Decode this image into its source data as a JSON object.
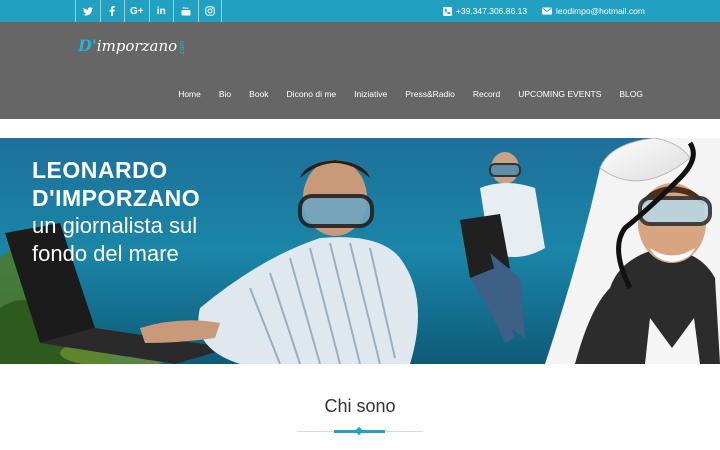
{
  "topbar": {
    "social": [
      {
        "icon": "twitter-icon",
        "glyph": "🐦"
      },
      {
        "icon": "facebook-icon",
        "glyph": "f"
      },
      {
        "icon": "google-plus-icon",
        "glyph": "G+"
      },
      {
        "icon": "linkedin-icon",
        "glyph": "in"
      },
      {
        "icon": "youtube-icon",
        "glyph": "▶"
      },
      {
        "icon": "instagram-icon",
        "glyph": "◎"
      }
    ],
    "phone": "+39.347.306.86.13",
    "email": "leodimpo@hotmail.com"
  },
  "header": {
    "logo": {
      "d": "D'",
      "rest": "imporzano",
      "com": ".com"
    },
    "nav": [
      "Home",
      "Bio",
      "Book",
      "Dicono di me",
      "Iniziative",
      "Press&Radio",
      "Record",
      "UPCOMING EVENTS",
      "BLOG"
    ]
  },
  "hero": {
    "line1": "LEONARDO",
    "line2": "D'IMPORZANO",
    "line3": "un giornalista sul",
    "line4": "fondo del mare"
  },
  "section": {
    "title": "Chi sono"
  },
  "colors": {
    "accent": "#21a0c2",
    "header_bg": "#666666"
  }
}
